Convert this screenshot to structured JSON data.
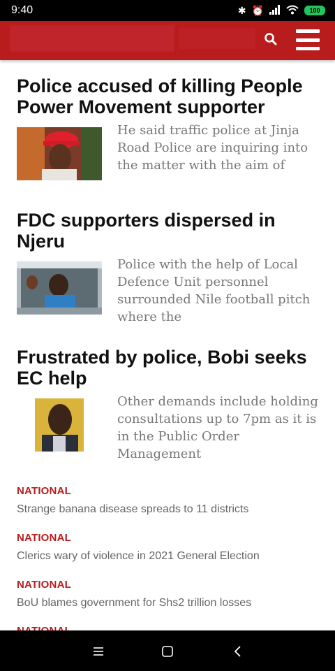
{
  "status_bar": {
    "time": "9:40",
    "battery": "100",
    "icons": [
      "bluetooth-icon",
      "alarm-off-icon",
      "signal-icon",
      "wifi-icon",
      "battery-icon"
    ]
  },
  "header": {
    "icons": [
      "search-icon",
      "hamburger-menu-icon"
    ],
    "accent_color": "#b91c1c"
  },
  "articles": [
    {
      "headline": "Police accused of killing People Power Movement supporter",
      "excerpt": "He said traffic police at Jinja\nRoad Police are inquiring into\nthe matter with the aim of"
    },
    {
      "headline": "FDC supporters dispersed in Njeru",
      "excerpt": " Police with the help of Local\nDefence Unit personnel\nsurrounded Nile football pitch\nwhere the"
    },
    {
      "headline": "Frustrated by police, Bobi seeks EC help",
      "excerpt": "Other demands include holding\nconsultations up to 7pm as it is\nin the Public Order Management"
    }
  ],
  "national_list": [
    {
      "category": "NATIONAL",
      "title": "Strange banana disease spreads to 11 districts"
    },
    {
      "category": "NATIONAL",
      "title": "Clerics wary of violence in 2021 General Election"
    },
    {
      "category": "NATIONAL",
      "title": "BoU blames government for Shs2 trillion losses"
    },
    {
      "category": "NATIONAL",
      "title": ""
    }
  ],
  "nav_bar": {
    "icons": [
      "recents-icon",
      "home-icon",
      "back-icon"
    ]
  }
}
